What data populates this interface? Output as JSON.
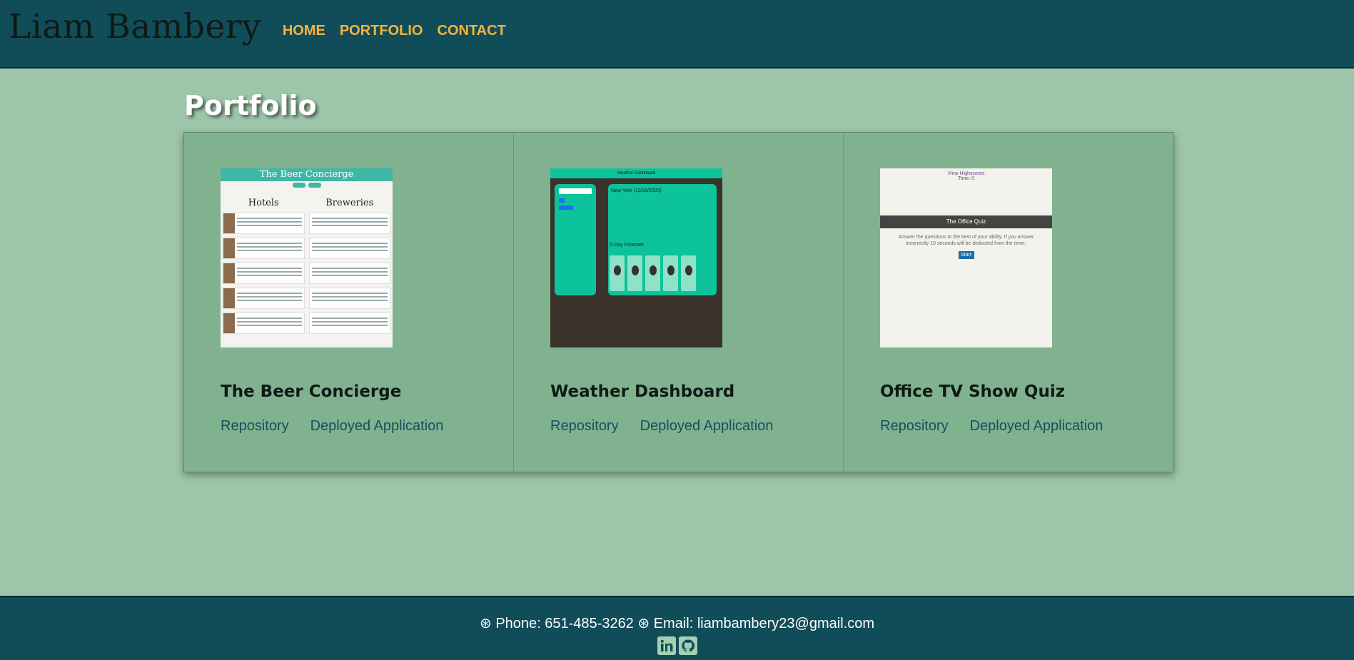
{
  "header": {
    "brand": "Liam Bambery",
    "nav": [
      "HOME",
      "PORTFOLIO",
      "CONTACT"
    ]
  },
  "main": {
    "title": "Portfolio",
    "projects": [
      {
        "title": "The Beer Concierge",
        "links": [
          "Repository",
          "Deployed Application"
        ],
        "thumb": {
          "app_title": "The Beer Concierge",
          "columns": [
            "Hotels",
            "Breweries"
          ]
        }
      },
      {
        "title": "Weather Dashboard",
        "links": [
          "Repository",
          "Deployed Application"
        ],
        "thumb": {
          "app_title": "Weather Dashboard",
          "city": "New York (11/18/2020)",
          "forecast_label": "5-Day Forecast"
        }
      },
      {
        "title": "Office TV Show Quiz",
        "links": [
          "Repository",
          "Deployed Application"
        ],
        "thumb": {
          "highscores_link": "View Highscores",
          "timer": "Time: 0",
          "quiz_title": "The Office Quiz",
          "instructions": "Answer the questions to the best of your ability. If you answer incorrectly 10 seconds will be deducted from the timer.",
          "start_label": "Start"
        }
      }
    ]
  },
  "footer": {
    "phone_text": "Phone: 651-485-3262",
    "email_text": "Email: liambambery23@gmail.com",
    "social_icons": [
      "linkedin-icon",
      "github-icon"
    ]
  },
  "colors": {
    "header_bg": "#114d59",
    "page_bg": "#9dc5a9",
    "panel_bg": "#80b290",
    "nav_link": "#f6b33e",
    "card_link": "#174f5e"
  }
}
